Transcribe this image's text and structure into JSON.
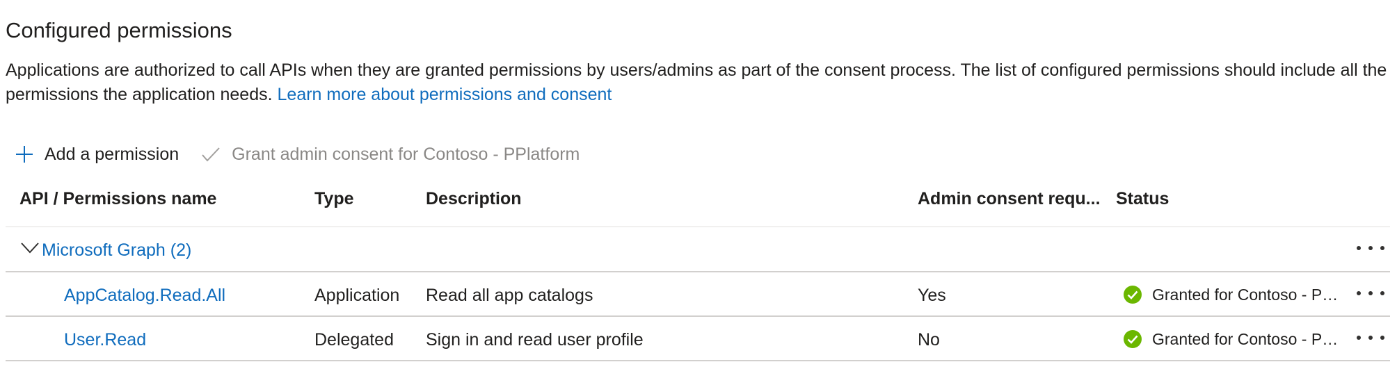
{
  "header": {
    "title": "Configured permissions",
    "description": "Applications are authorized to call APIs when they are granted permissions by users/admins as part of the consent process. The list of configured permissions should include all the permissions the application needs.",
    "learn_more_link": "Learn more about permissions and consent"
  },
  "toolbar": {
    "add_permission_label": "Add a permission",
    "add_icon": "plus-icon",
    "grant_consent_label": "Grant admin consent for Contoso - PPlatform",
    "grant_icon": "checkmark-icon"
  },
  "table": {
    "columns": [
      "API / Permissions name",
      "Type",
      "Description",
      "Admin consent requ...",
      "Status"
    ],
    "groups": [
      {
        "name": "Microsoft Graph (2)",
        "expanded": true,
        "rows": [
          {
            "name": "AppCatalog.Read.All",
            "type": "Application",
            "description": "Read all app catalogs",
            "admin_consent": "Yes",
            "status": "Granted for Contoso - PPlatform",
            "status_icon": "check-circle-icon"
          },
          {
            "name": "User.Read",
            "type": "Delegated",
            "description": "Sign in and read user profile",
            "admin_consent": "No",
            "status": "Granted for Contoso - PPlatform",
            "status_icon": "check-circle-icon"
          }
        ]
      }
    ]
  },
  "colors": {
    "link": "#0f6cbd",
    "success": "#6bb700",
    "disabled_text": "#8a8886"
  }
}
